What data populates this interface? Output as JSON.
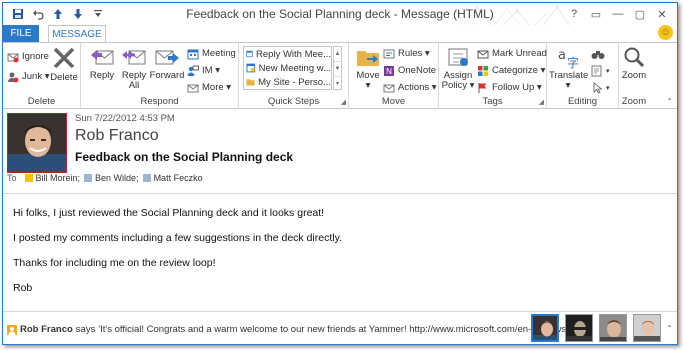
{
  "window": {
    "title": "Feedback on the Social Planning deck - Message (HTML)"
  },
  "titlebar": {
    "controls": [
      "?",
      "▭",
      "—",
      "▢",
      "✕"
    ]
  },
  "tabs": {
    "file": "FILE",
    "message": "MESSAGE"
  },
  "ribbon": {
    "delete": {
      "label": "Delete",
      "ignore": "Ignore",
      "junk": "Junk ▾",
      "delete_btn": "Delete"
    },
    "respond": {
      "label": "Respond",
      "reply": "Reply",
      "reply_all_1": "Reply",
      "reply_all_2": "All",
      "forward": "Forward",
      "meeting": "Meeting",
      "im": "IM ▾",
      "more": "More ▾"
    },
    "quick_steps": {
      "label": "Quick Steps",
      "items": [
        "Reply With Mee...",
        "New Meeting w...",
        "My Site - Perso..."
      ]
    },
    "move": {
      "label": "Move",
      "move_btn_1": "Move",
      "move_btn_2": "▾",
      "rules": "Rules ▾",
      "onenote": "OneNote",
      "actions": "Actions ▾"
    },
    "tags": {
      "label": "Tags",
      "assign_1": "Assign",
      "assign_2": "Policy ▾",
      "mark_unread": "Mark Unread",
      "categorize": "Categorize ▾",
      "follow_up": "Follow Up ▾"
    },
    "editing": {
      "label": "Editing",
      "translate_1": "Translate",
      "translate_2": "▾"
    },
    "zoom": {
      "label": "Zoom",
      "zoom_btn": "Zoom"
    }
  },
  "message": {
    "date": "Sun 7/22/2012 4:53 PM",
    "sender": "Rob Franco",
    "subject": "Feedback on the Social Planning deck",
    "to_label": "To",
    "recipients": [
      {
        "name": "Bill Morein;",
        "color": "#f5c400"
      },
      {
        "name": "Ben Wilde;",
        "color": "#9ab7cf"
      },
      {
        "name": "Matt Feczko",
        "color": "#9ab7cf"
      }
    ],
    "body": [
      "Hi folks, I just reviewed the Social Planning deck and it looks great!",
      "I posted my comments including a few suggestions in the deck directly.",
      "Thanks for including me on the review loop!",
      "Rob"
    ]
  },
  "people_pane": {
    "name": "Rob Franco",
    "says": "says",
    "status": "'It's official! Congrats and a warm welcome to our new friends at Yammer! http://www.microsoft.com/en-us/news..."
  },
  "colors": {
    "accent": "#2b79c9",
    "file_tab": "#2b79c9"
  }
}
